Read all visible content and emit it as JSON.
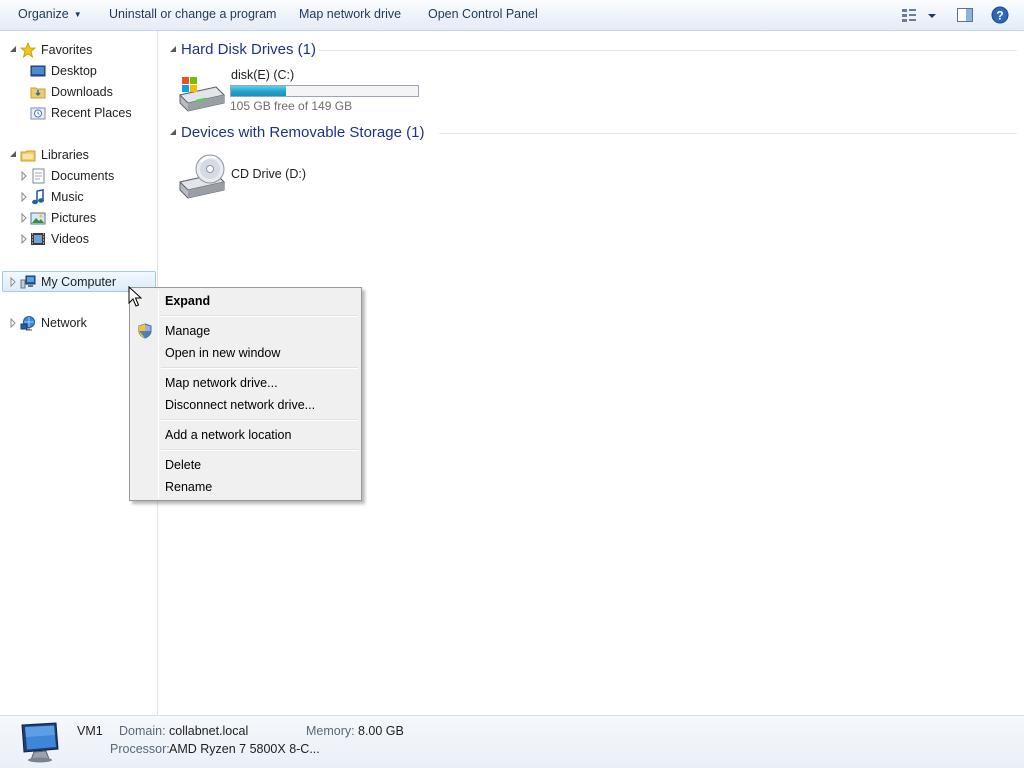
{
  "toolbar": {
    "organize": "Organize",
    "uninstall": "Uninstall or change a program",
    "map_drive": "Map network drive",
    "control_panel": "Open Control Panel"
  },
  "nav": {
    "favorites": {
      "label": "Favorites",
      "items": [
        "Desktop",
        "Downloads",
        "Recent Places"
      ]
    },
    "libraries": {
      "label": "Libraries",
      "items": [
        "Documents",
        "Music",
        "Pictures",
        "Videos"
      ]
    },
    "computer": "My Computer",
    "network": "Network"
  },
  "content": {
    "hdd_group": "Hard Disk Drives (1)",
    "drive_c": {
      "label": "disk(E) (C:)",
      "free_text": "105 GB free of 149 GB",
      "used_fraction": 0.295
    },
    "removable_group": "Devices with Removable Storage (1)",
    "cd_drive": {
      "label": "CD Drive (D:)"
    }
  },
  "context_menu": {
    "expand": "Expand",
    "manage": "Manage",
    "open_new_window": "Open in new window",
    "map_network_drive": "Map network drive...",
    "disconnect_network_drive": "Disconnect network drive...",
    "add_network_location": "Add a network location",
    "delete": "Delete",
    "rename": "Rename"
  },
  "details": {
    "name": "VM1",
    "domain_label": "Domain:",
    "domain_value": "collabnet.local",
    "memory_label": "Memory:",
    "memory_value": "8.00 GB",
    "processor_label": "Processor:",
    "processor_value": "AMD Ryzen 7 5800X 8-C..."
  },
  "colors": {
    "group_header": "#1e3287",
    "capacity_fill": "#23a7cf",
    "selection_border": "#a4c8ef"
  }
}
